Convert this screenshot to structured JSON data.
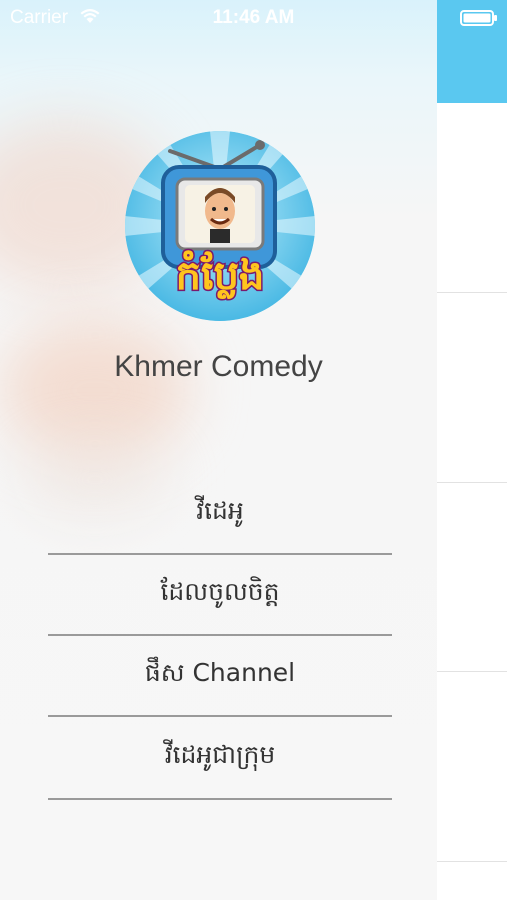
{
  "status_bar": {
    "carrier": "Carrier",
    "time": "11:46 AM",
    "wifi_icon": "wifi-icon",
    "battery_icon": "battery-icon"
  },
  "drawer": {
    "logo_icon": "khmer-comedy-logo",
    "logo_text": "កំប្លែង",
    "app_name": "Khmer Comedy",
    "menu": [
      {
        "label": "វីដេអូ"
      },
      {
        "label": "ដែលចូលចិត្ត"
      },
      {
        "label": "ផឹស Channel"
      },
      {
        "label": "វីដេអូជាក្រុម"
      }
    ]
  },
  "colors": {
    "navbar": "#5ac8f0",
    "drawer_background": "#f7f7f7",
    "divider": "#9a9a9a"
  }
}
